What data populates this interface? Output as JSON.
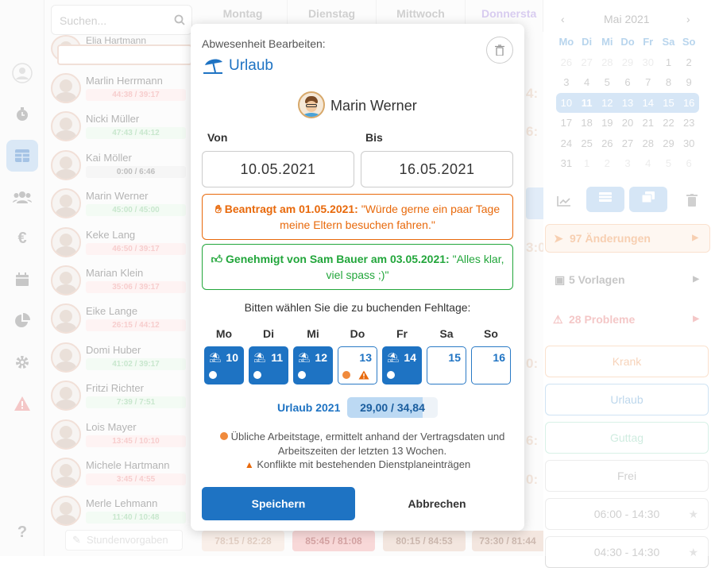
{
  "search": {
    "placeholder": "Suchen..."
  },
  "employees": [
    {
      "name": "Elia Hartmann",
      "hours": ""
    },
    {
      "name": "Marlin Herrmann",
      "hours": "44:38 / 39:17",
      "status": "red"
    },
    {
      "name": "Nicki Müller",
      "hours": "47:43 / 44:12",
      "status": "grn"
    },
    {
      "name": "Kai Möller",
      "hours": "0:00 / 6:46",
      "status": "gry"
    },
    {
      "name": "Marin Werner",
      "hours": "45:00 / 45:00",
      "status": "grn"
    },
    {
      "name": "Keke Lang",
      "hours": "46:50 / 39:17",
      "status": "red"
    },
    {
      "name": "Marian Klein",
      "hours": "35:06 / 39:17",
      "status": "red"
    },
    {
      "name": "Eike Lange",
      "hours": "26:15 / 44:12",
      "status": "red"
    },
    {
      "name": "Domi Huber",
      "hours": "41:02 / 39:17",
      "status": "grn"
    },
    {
      "name": "Fritzi Richter",
      "hours": "7:39 / 7:51",
      "status": "grn"
    },
    {
      "name": "Lois Mayer",
      "hours": "13:45 / 10:10",
      "status": "red"
    },
    {
      "name": "Michele Hartmann",
      "hours": "3:45 / 4:55",
      "status": "red"
    },
    {
      "name": "Merle Lehmann",
      "hours": "11:40 / 10:48",
      "status": "grn"
    }
  ],
  "footer": {
    "stundenvorgaben": "Stundenvorgaben"
  },
  "calendar": {
    "days": [
      "Montag",
      "Dienstag",
      "Mittwoch",
      "Donnersta"
    ],
    "bottom_totals": [
      "78:15 / 82:28",
      "85:45 / 81:08",
      "80:15 / 84:53",
      "73:30 / 81:44"
    ]
  },
  "mini_calendar": {
    "month": "Mai 2021",
    "weekdays": [
      "Mo",
      "Di",
      "Mi",
      "Do",
      "Fr",
      "Sa",
      "So"
    ],
    "weeks": [
      [
        "26",
        "27",
        "28",
        "29",
        "30",
        "1",
        "2"
      ],
      [
        "3",
        "4",
        "5",
        "6",
        "7",
        "8",
        "9"
      ],
      [
        "10",
        "11",
        "12",
        "13",
        "14",
        "15",
        "16"
      ],
      [
        "17",
        "18",
        "19",
        "20",
        "21",
        "22",
        "23"
      ],
      [
        "24",
        "25",
        "26",
        "27",
        "28",
        "29",
        "30"
      ],
      [
        "31",
        "1",
        "2",
        "3",
        "4",
        "5",
        "6"
      ]
    ]
  },
  "right_panel": {
    "changes": "97 Änderungen",
    "templates": "5 Vorlagen",
    "problems": "28 Probleme",
    "buttons": [
      "Krank",
      "Urlaub",
      "Guttag",
      "Frei",
      "06:00 - 14:30",
      "04:30 - 14:30"
    ]
  },
  "modal": {
    "heading": "Abwesenheit Bearbeiten:",
    "type": "Urlaub",
    "employee": "Marin Werner",
    "from_label": "Von",
    "to_label": "Bis",
    "from": "10.05.2021",
    "to": "16.05.2021",
    "requested_bold": "Beantragt am 01.05.2021:",
    "requested_text": " \"Würde gerne ein paar Tage meine Eltern besuchen fahren.\"",
    "approved_bold": "Genehmigt von Sam Bauer am 03.05.2021:",
    "approved_text": " \"Alles klar, viel spass ;)\"",
    "choose_days": "Bitten wählen Sie die zu buchenden Fehltage:",
    "weekdays": [
      "Mo",
      "Di",
      "Mi",
      "Do",
      "Fr",
      "Sa",
      "So"
    ],
    "day_numbers": [
      "10",
      "11",
      "12",
      "13",
      "14",
      "15",
      "16"
    ],
    "quota_label": "Urlaub 2021",
    "quota_value": "29,00 / 34,84",
    "quota_fraction": 0.83,
    "legend_workdays": "Übliche Arbeitstage, ermittelt anhand der Vertragsdaten und Arbeitszeiten der letzten 13 Wochen.",
    "legend_conflicts": "Konflikte mit bestehenden Dienstplaneinträgen",
    "save": "Speichern",
    "cancel": "Abbrechen"
  },
  "colors": {
    "primary": "#1e73c3",
    "warning": "#e8690b",
    "success": "#22a63b"
  }
}
